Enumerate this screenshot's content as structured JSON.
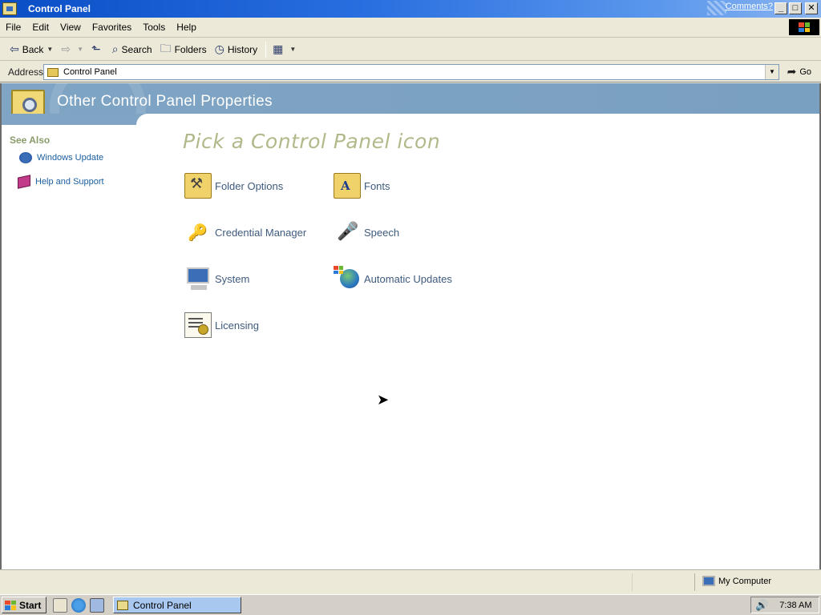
{
  "window": {
    "title": "Control Panel",
    "comments": "Comments?",
    "btn_min": "_",
    "btn_max": "□",
    "btn_close": "✕"
  },
  "menu": [
    "File",
    "Edit",
    "View",
    "Favorites",
    "Tools",
    "Help"
  ],
  "toolbar": {
    "back": "Back",
    "search": "Search",
    "folders": "Folders",
    "history": "History"
  },
  "address": {
    "label": "Address",
    "value": "Control Panel",
    "go": "Go"
  },
  "banner": {
    "title": "Other Control Panel Properties"
  },
  "sidebar": {
    "see_also": "See Also",
    "links": [
      "Windows Update",
      "Help and Support"
    ]
  },
  "main": {
    "heading": "Pick a Control Panel icon",
    "items": [
      {
        "label": "Folder Options",
        "icon": "folder-options-icon"
      },
      {
        "label": "Fonts",
        "icon": "fonts-icon"
      },
      {
        "label": "Credential Manager",
        "icon": "key-icon"
      },
      {
        "label": "Speech",
        "icon": "microphone-icon"
      },
      {
        "label": "System",
        "icon": "computer-icon"
      },
      {
        "label": "Automatic Updates",
        "icon": "globe-icon"
      },
      {
        "label": "Licensing",
        "icon": "certificate-icon"
      }
    ]
  },
  "statusbar": {
    "zone": "My Computer"
  },
  "taskbar": {
    "start": "Start",
    "task": "Control Panel",
    "clock": "7:38 AM"
  },
  "colors": {
    "titlebar": "#0a4ec6",
    "banner": "#7fa4c4",
    "heading": "#b3b88a",
    "item_label": "#3e5a7d",
    "link": "#1a5fa0"
  }
}
